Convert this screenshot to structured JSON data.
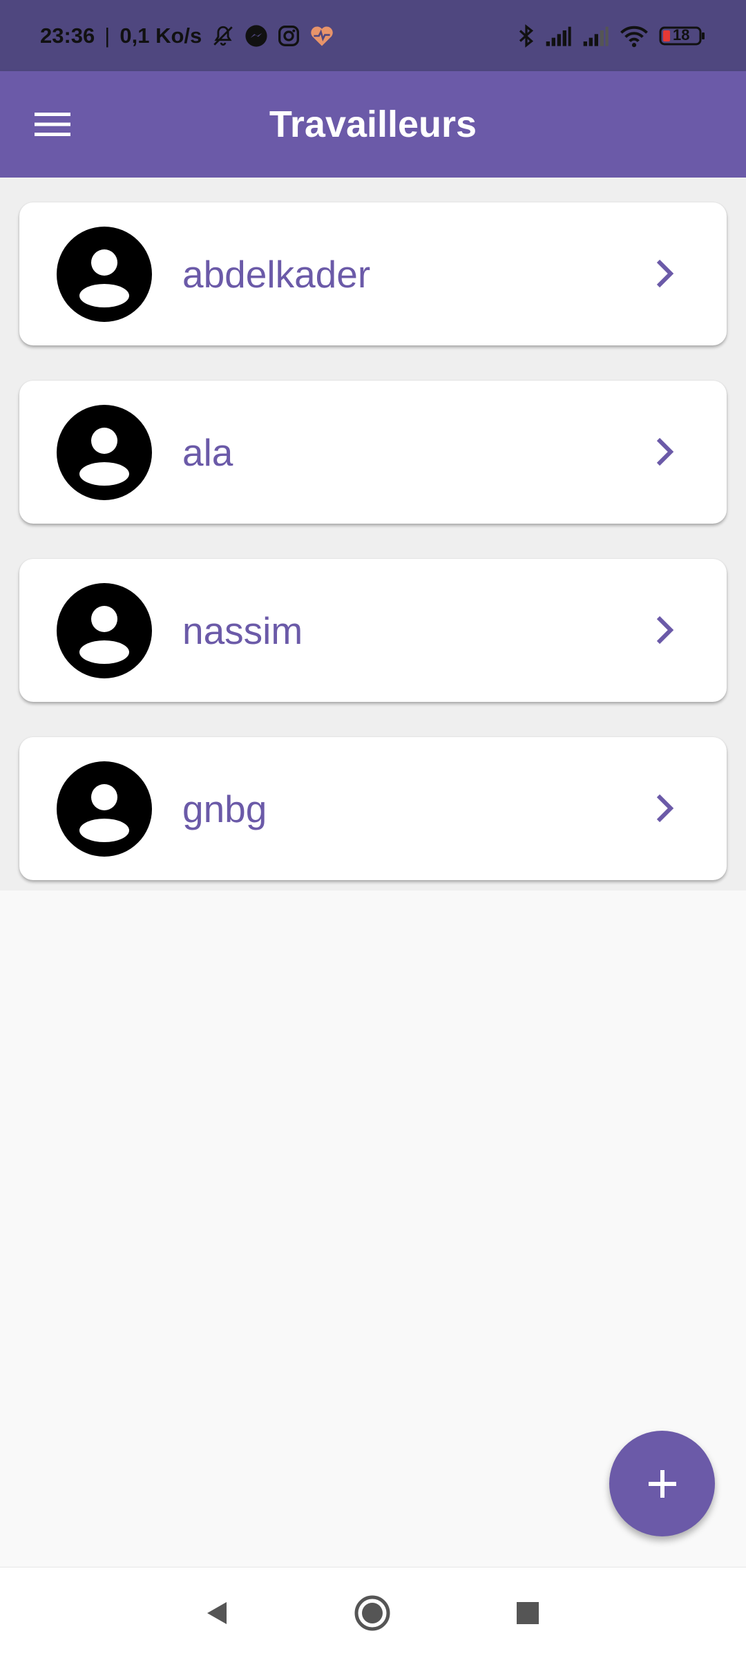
{
  "status_bar": {
    "time": "23:36",
    "separator": "|",
    "speed": "0,1 Ko/s",
    "battery": "18",
    "icons": [
      "bell-off-icon",
      "messenger-icon",
      "instagram-icon",
      "health-heart-icon",
      "bluetooth-icon",
      "signal-icon",
      "signal-icon",
      "wifi-icon",
      "battery-icon"
    ]
  },
  "app_bar": {
    "title": "Travailleurs",
    "menu_icon": "hamburger-menu-icon"
  },
  "workers": [
    {
      "name": "abdelkader",
      "icon": "account-circle-icon",
      "action_icon": "chevron-right-icon"
    },
    {
      "name": "ala",
      "icon": "account-circle-icon",
      "action_icon": "chevron-right-icon"
    },
    {
      "name": "nassim",
      "icon": "account-circle-icon",
      "action_icon": "chevron-right-icon"
    },
    {
      "name": "gnbg",
      "icon": "account-circle-icon",
      "action_icon": "chevron-right-icon"
    }
  ],
  "fab": {
    "icon": "plus-icon"
  },
  "nav_bar": {
    "icons": [
      "back-icon",
      "home-icon",
      "recents-icon"
    ]
  },
  "colors": {
    "primary": "#6b5aa8",
    "status_bar": "#4f477f",
    "background": "#f9f9f9",
    "card": "#ffffff",
    "battery_low": "#e53935"
  }
}
